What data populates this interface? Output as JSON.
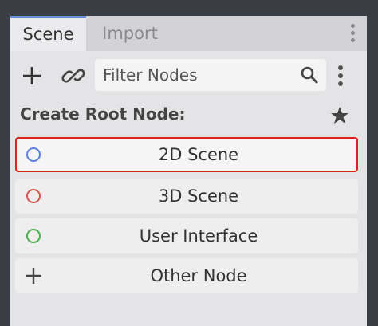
{
  "tabs": [
    {
      "label": "Scene",
      "active": true
    },
    {
      "label": "Import",
      "active": false
    }
  ],
  "toolbar": {
    "add_icon": "plus-icon",
    "link_icon": "link-icon",
    "filter_placeholder": "Filter Nodes",
    "search_icon": "search-icon",
    "menu_icon": "kebab-menu-icon"
  },
  "section": {
    "title": "Create Root Node:",
    "favorites_icon": "star-icon"
  },
  "root_nodes": [
    {
      "label": "2D Scene",
      "icon": "node2d-circle-icon",
      "color": "#5a7fd6",
      "selected": true
    },
    {
      "label": "3D Scene",
      "icon": "node3d-circle-icon",
      "color": "#d9534f",
      "selected": false
    },
    {
      "label": "User Interface",
      "icon": "control-circle-icon",
      "color": "#4caf50",
      "selected": false
    },
    {
      "label": "Other Node",
      "icon": "plus-icon",
      "color": "#444444",
      "selected": false
    }
  ],
  "colors": {
    "accent": "#6b8ed6",
    "selection_border": "#dd2222"
  }
}
